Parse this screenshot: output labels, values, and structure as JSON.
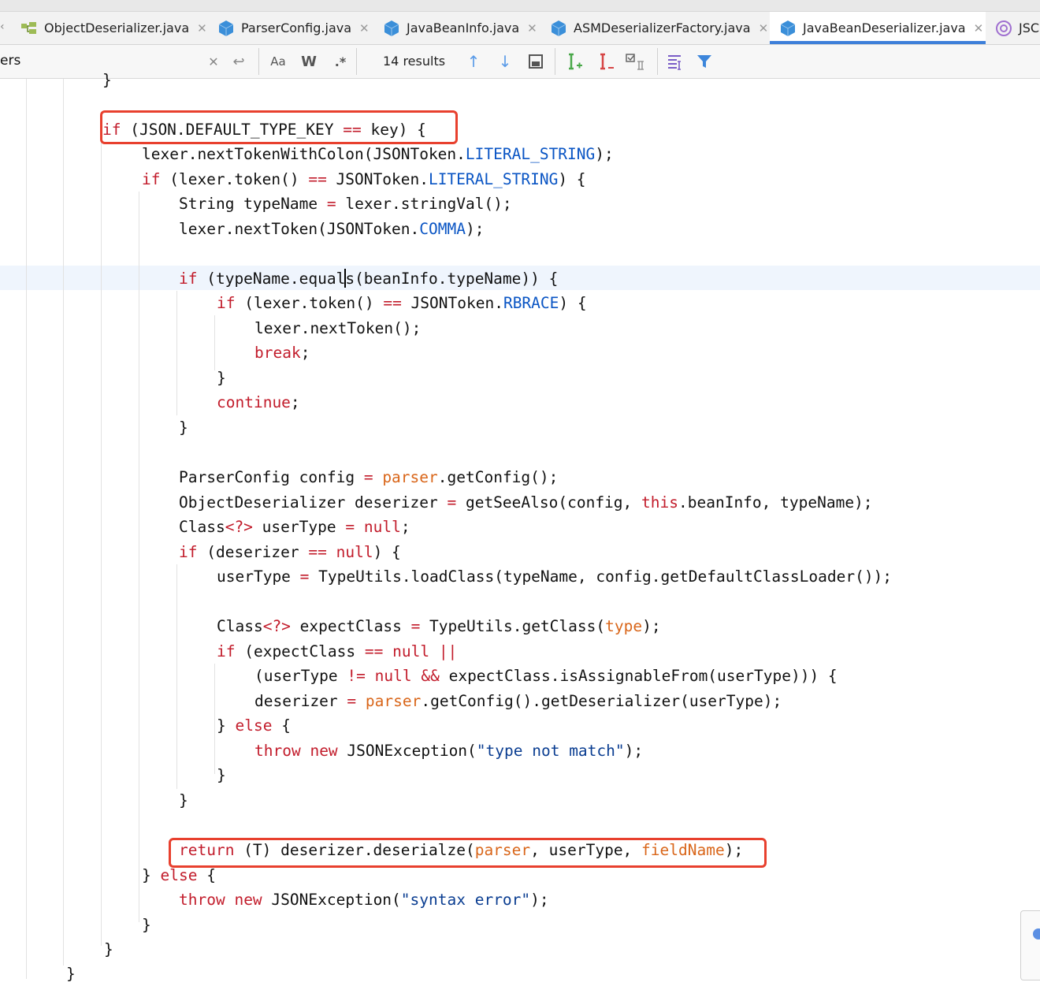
{
  "tabs": [
    {
      "label": "ObjectDeserializer.java",
      "icon": "structure-icon",
      "active": false
    },
    {
      "label": "ParserConfig.java",
      "icon": "class-icon",
      "active": false
    },
    {
      "label": "JavaBeanInfo.java",
      "icon": "class-icon",
      "active": false
    },
    {
      "label": "ASMDeserializerFactory.java",
      "icon": "class-icon",
      "active": false
    },
    {
      "label": "JavaBeanDeserializer.java",
      "icon": "class-icon",
      "active": true
    },
    {
      "label": "JSC",
      "icon": "annotation-icon",
      "active": false
    }
  ],
  "find": {
    "query": "ers",
    "match_case": "Aa",
    "words": "W",
    "regex": ".*",
    "results": "14 results"
  },
  "code_lines": [
    "}",
    "",
    "if (JSON.DEFAULT_TYPE_KEY == key) {",
    "lexer.nextTokenWithColon(JSONToken.LITERAL_STRING);",
    "if (lexer.token() == JSONToken.LITERAL_STRING) {",
    "String typeName = lexer.stringVal();",
    "lexer.nextToken(JSONToken.COMMA);",
    "",
    "if (typeName.equals(beanInfo.typeName)) {",
    "if (lexer.token() == JSONToken.RBRACE) {",
    "lexer.nextToken();",
    "break;",
    "}",
    "continue;",
    "}",
    "",
    "ParserConfig config = parser.getConfig();",
    "ObjectDeserializer deserizer = getSeeAlso(config, this.beanInfo, typeName);",
    "Class<?> userType = null;",
    "if (deserizer == null) {",
    "userType = TypeUtils.loadClass(typeName, config.getDefaultClassLoader());",
    "",
    "Class<?> expectClass = TypeUtils.getClass(type);",
    "if (expectClass == null ||",
    "(userType != null && expectClass.isAssignableFrom(userType))) {",
    "deserizer = parser.getConfig().getDeserializer(userType);",
    "} else {",
    "throw new JSONException(\"type not match\");",
    "}",
    "}",
    "",
    "return (T) deserizer.deserialze(parser, userType, fieldName);",
    "} else {",
    "throw new JSONException(\"syntax error\");",
    "}",
    "}",
    "}"
  ],
  "colors": {
    "keyword": "#c21c2b",
    "constant": "#0a55c4",
    "parameter": "#d9661a",
    "string": "#0a3d91",
    "highlight_box": "#e8402e",
    "active_tab_underline": "#3d7fd9"
  }
}
